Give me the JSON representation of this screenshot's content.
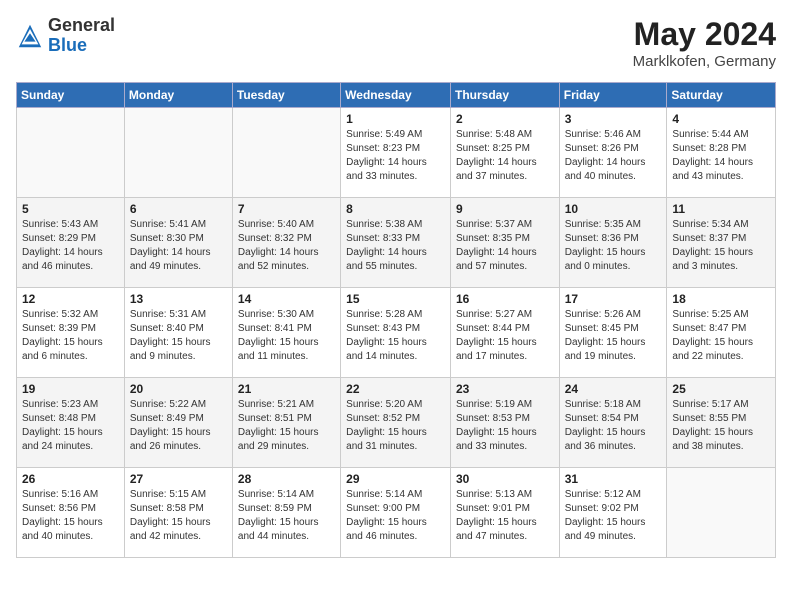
{
  "header": {
    "logo_general": "General",
    "logo_blue": "Blue",
    "month_title": "May 2024",
    "location": "Marklkofen, Germany"
  },
  "days_of_week": [
    "Sunday",
    "Monday",
    "Tuesday",
    "Wednesday",
    "Thursday",
    "Friday",
    "Saturday"
  ],
  "weeks": [
    [
      {
        "day": "",
        "info": ""
      },
      {
        "day": "",
        "info": ""
      },
      {
        "day": "",
        "info": ""
      },
      {
        "day": "1",
        "info": "Sunrise: 5:49 AM\nSunset: 8:23 PM\nDaylight: 14 hours\nand 33 minutes."
      },
      {
        "day": "2",
        "info": "Sunrise: 5:48 AM\nSunset: 8:25 PM\nDaylight: 14 hours\nand 37 minutes."
      },
      {
        "day": "3",
        "info": "Sunrise: 5:46 AM\nSunset: 8:26 PM\nDaylight: 14 hours\nand 40 minutes."
      },
      {
        "day": "4",
        "info": "Sunrise: 5:44 AM\nSunset: 8:28 PM\nDaylight: 14 hours\nand 43 minutes."
      }
    ],
    [
      {
        "day": "5",
        "info": "Sunrise: 5:43 AM\nSunset: 8:29 PM\nDaylight: 14 hours\nand 46 minutes."
      },
      {
        "day": "6",
        "info": "Sunrise: 5:41 AM\nSunset: 8:30 PM\nDaylight: 14 hours\nand 49 minutes."
      },
      {
        "day": "7",
        "info": "Sunrise: 5:40 AM\nSunset: 8:32 PM\nDaylight: 14 hours\nand 52 minutes."
      },
      {
        "day": "8",
        "info": "Sunrise: 5:38 AM\nSunset: 8:33 PM\nDaylight: 14 hours\nand 55 minutes."
      },
      {
        "day": "9",
        "info": "Sunrise: 5:37 AM\nSunset: 8:35 PM\nDaylight: 14 hours\nand 57 minutes."
      },
      {
        "day": "10",
        "info": "Sunrise: 5:35 AM\nSunset: 8:36 PM\nDaylight: 15 hours\nand 0 minutes."
      },
      {
        "day": "11",
        "info": "Sunrise: 5:34 AM\nSunset: 8:37 PM\nDaylight: 15 hours\nand 3 minutes."
      }
    ],
    [
      {
        "day": "12",
        "info": "Sunrise: 5:32 AM\nSunset: 8:39 PM\nDaylight: 15 hours\nand 6 minutes."
      },
      {
        "day": "13",
        "info": "Sunrise: 5:31 AM\nSunset: 8:40 PM\nDaylight: 15 hours\nand 9 minutes."
      },
      {
        "day": "14",
        "info": "Sunrise: 5:30 AM\nSunset: 8:41 PM\nDaylight: 15 hours\nand 11 minutes."
      },
      {
        "day": "15",
        "info": "Sunrise: 5:28 AM\nSunset: 8:43 PM\nDaylight: 15 hours\nand 14 minutes."
      },
      {
        "day": "16",
        "info": "Sunrise: 5:27 AM\nSunset: 8:44 PM\nDaylight: 15 hours\nand 17 minutes."
      },
      {
        "day": "17",
        "info": "Sunrise: 5:26 AM\nSunset: 8:45 PM\nDaylight: 15 hours\nand 19 minutes."
      },
      {
        "day": "18",
        "info": "Sunrise: 5:25 AM\nSunset: 8:47 PM\nDaylight: 15 hours\nand 22 minutes."
      }
    ],
    [
      {
        "day": "19",
        "info": "Sunrise: 5:23 AM\nSunset: 8:48 PM\nDaylight: 15 hours\nand 24 minutes."
      },
      {
        "day": "20",
        "info": "Sunrise: 5:22 AM\nSunset: 8:49 PM\nDaylight: 15 hours\nand 26 minutes."
      },
      {
        "day": "21",
        "info": "Sunrise: 5:21 AM\nSunset: 8:51 PM\nDaylight: 15 hours\nand 29 minutes."
      },
      {
        "day": "22",
        "info": "Sunrise: 5:20 AM\nSunset: 8:52 PM\nDaylight: 15 hours\nand 31 minutes."
      },
      {
        "day": "23",
        "info": "Sunrise: 5:19 AM\nSunset: 8:53 PM\nDaylight: 15 hours\nand 33 minutes."
      },
      {
        "day": "24",
        "info": "Sunrise: 5:18 AM\nSunset: 8:54 PM\nDaylight: 15 hours\nand 36 minutes."
      },
      {
        "day": "25",
        "info": "Sunrise: 5:17 AM\nSunset: 8:55 PM\nDaylight: 15 hours\nand 38 minutes."
      }
    ],
    [
      {
        "day": "26",
        "info": "Sunrise: 5:16 AM\nSunset: 8:56 PM\nDaylight: 15 hours\nand 40 minutes."
      },
      {
        "day": "27",
        "info": "Sunrise: 5:15 AM\nSunset: 8:58 PM\nDaylight: 15 hours\nand 42 minutes."
      },
      {
        "day": "28",
        "info": "Sunrise: 5:14 AM\nSunset: 8:59 PM\nDaylight: 15 hours\nand 44 minutes."
      },
      {
        "day": "29",
        "info": "Sunrise: 5:14 AM\nSunset: 9:00 PM\nDaylight: 15 hours\nand 46 minutes."
      },
      {
        "day": "30",
        "info": "Sunrise: 5:13 AM\nSunset: 9:01 PM\nDaylight: 15 hours\nand 47 minutes."
      },
      {
        "day": "31",
        "info": "Sunrise: 5:12 AM\nSunset: 9:02 PM\nDaylight: 15 hours\nand 49 minutes."
      },
      {
        "day": "",
        "info": ""
      }
    ]
  ]
}
